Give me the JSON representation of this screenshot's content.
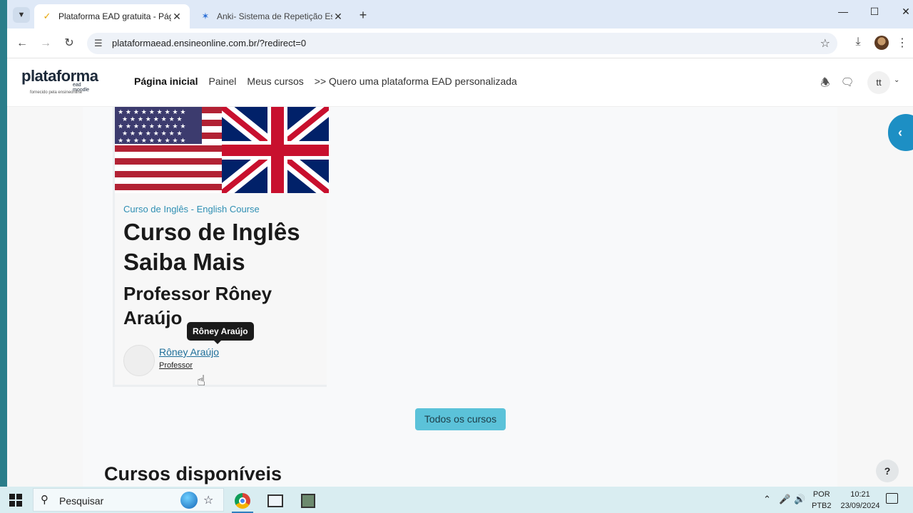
{
  "browser": {
    "tabs": [
      {
        "title": "Plataforma EAD gratuita - Págin",
        "active": true
      },
      {
        "title": "Anki- Sistema de Repetição Esp",
        "active": false
      }
    ],
    "url": "plataformaead.ensineonline.com.br/?redirect=0"
  },
  "site": {
    "logo_main": "plataforma",
    "logo_sub": "ead moodle",
    "logo_tagline": "fornecido pela ensineonline",
    "nav": {
      "home": "Página inicial",
      "painel": "Painel",
      "meus_cursos": "Meus cursos",
      "personalizada": ">> Quero uma plataforma EAD personalizada"
    },
    "user_initials": "tt"
  },
  "course_card": {
    "category": "Curso de Inglês - English Course",
    "title": "Curso de Inglês Saiba Mais",
    "subtitle": "Professor Rôney Araújo",
    "teacher_name": "Rôney Araújo",
    "teacher_role": "Professor",
    "tooltip": "Rôney Araújo"
  },
  "main": {
    "all_courses_button": "Todos os cursos",
    "section_title": "Cursos disponíveis",
    "help_label": "?"
  },
  "taskbar": {
    "search_placeholder": "Pesquisar",
    "language_line1": "POR",
    "language_line2": "PTB2",
    "time": "10:21",
    "date": "23/09/2024"
  },
  "colors": {
    "accent": "#1d8fc4",
    "button": "#5bc2d9",
    "link": "#2f8fb3"
  }
}
